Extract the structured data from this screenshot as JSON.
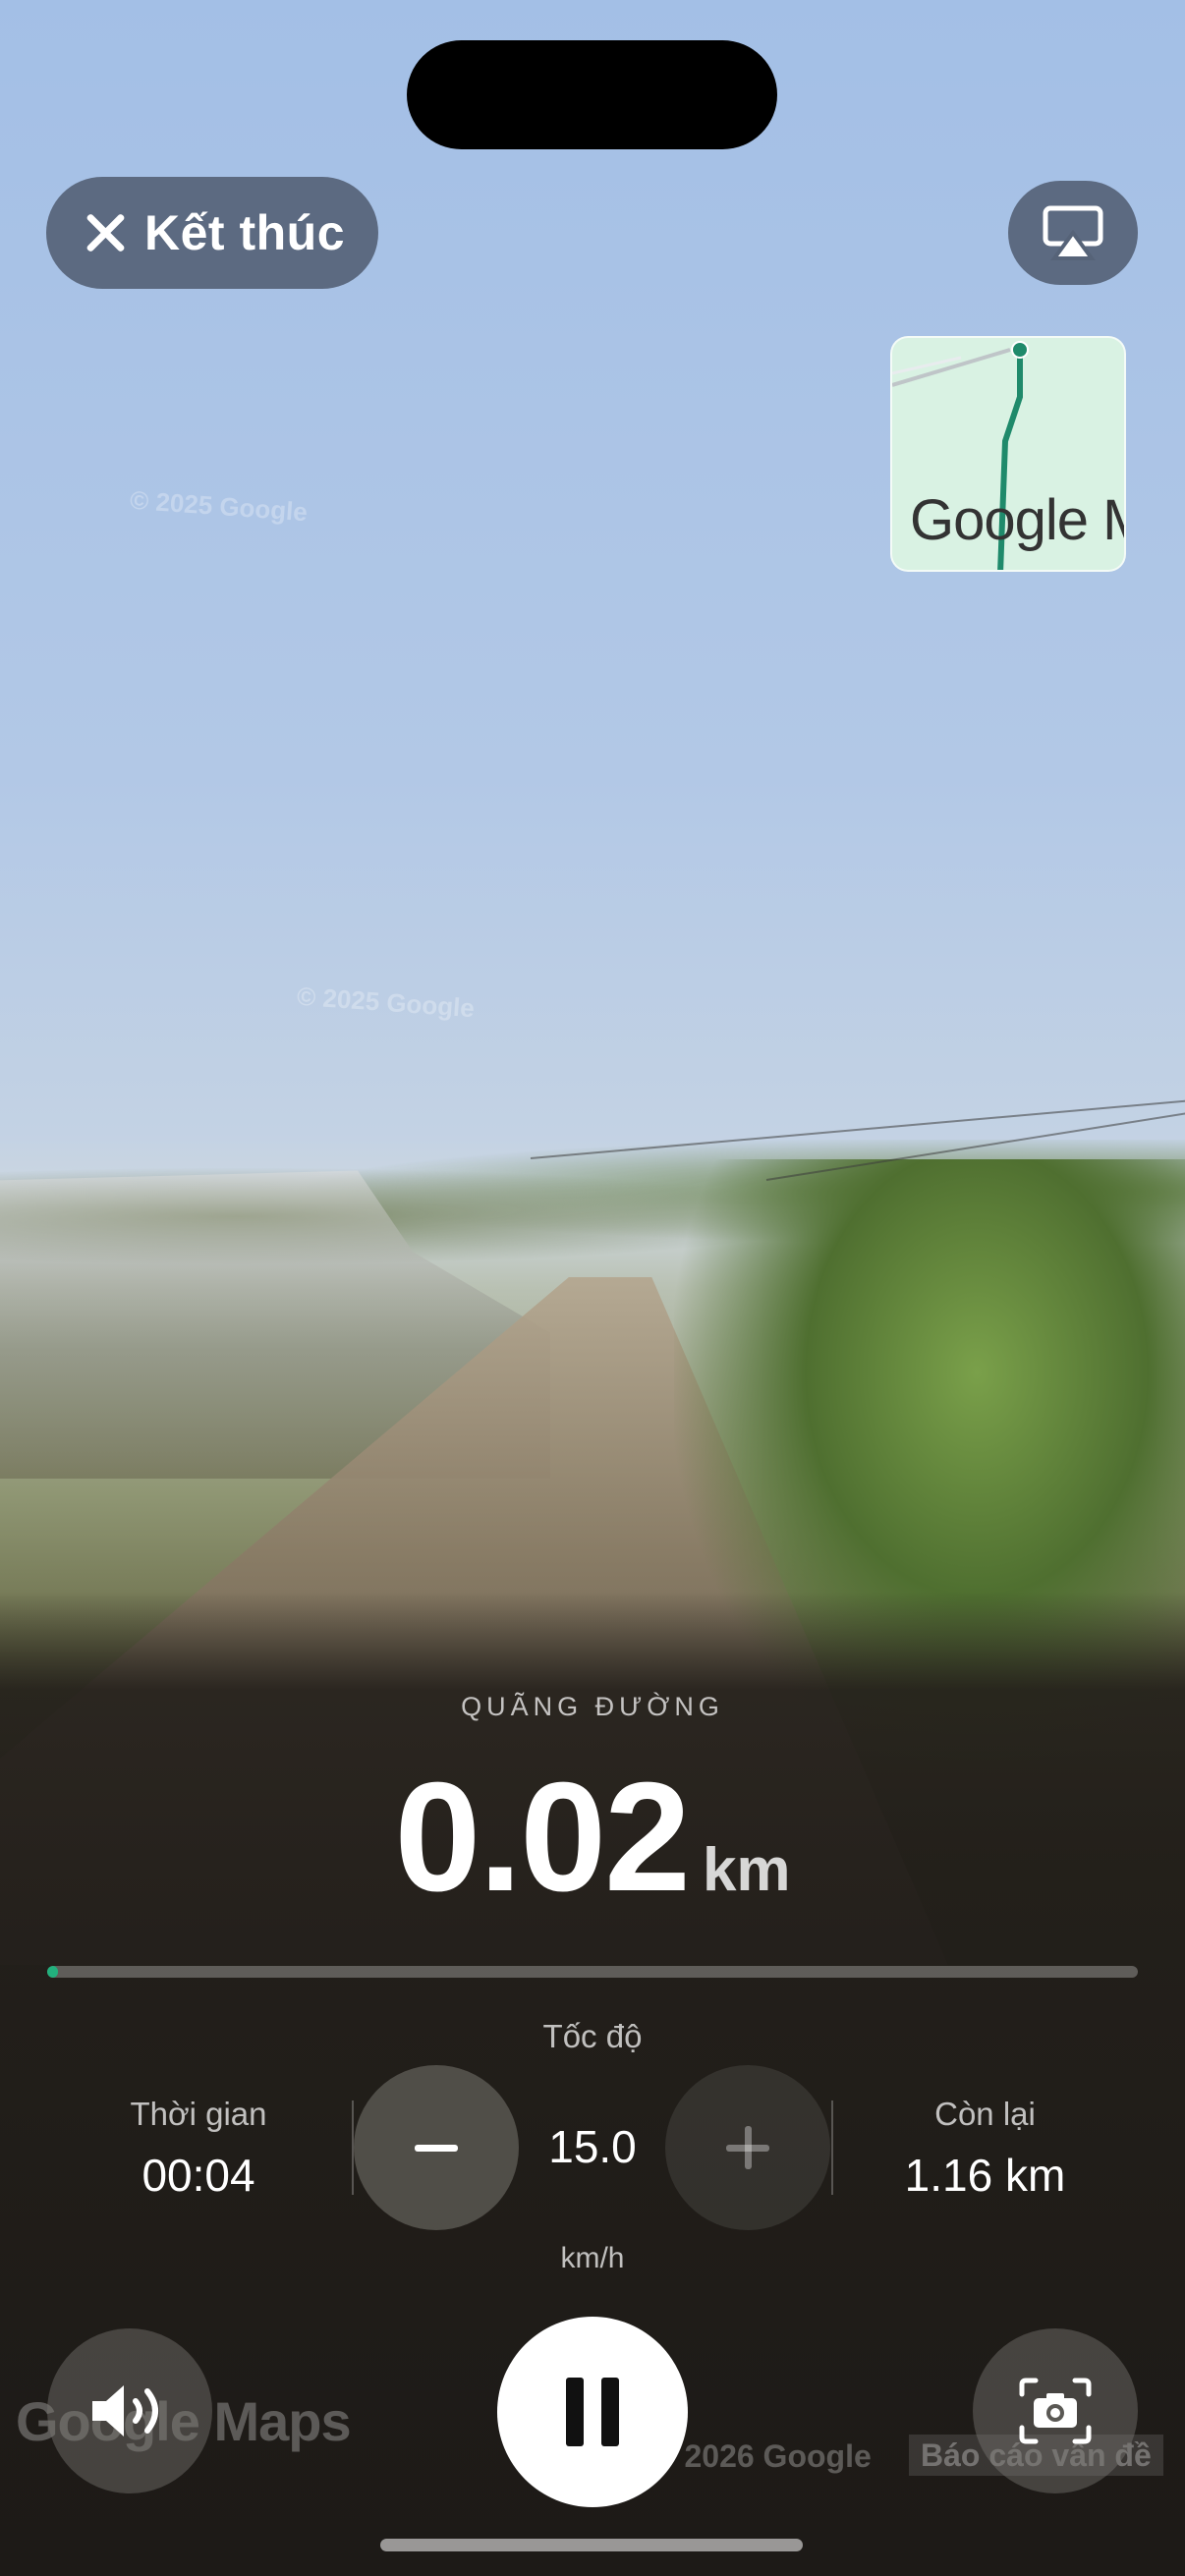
{
  "top_bar": {
    "end_button_label": "Kết thúc"
  },
  "minimap": {
    "label": "Google M"
  },
  "watermarks": {
    "street_view_1": "© 2025 Google",
    "street_view_2": "© 2025 Google",
    "google_maps": "Google Maps",
    "copyright": "© 2026 Google",
    "report": "Báo cáo vấn đề"
  },
  "distance": {
    "caption": "QUÃNG ĐƯỜNG",
    "value": "0.02",
    "unit": "km",
    "progress_fraction": 0.01
  },
  "speed": {
    "caption": "Tốc độ",
    "value": "15.0",
    "unit": "km/h"
  },
  "stats": {
    "time_label": "Thời gian",
    "time_value": "00:04",
    "remaining_label": "Còn lại",
    "remaining_value": "1.16 km"
  },
  "colors": {
    "accent": "#22b07d",
    "pill_background": "#566378"
  },
  "icons": [
    "close-icon",
    "airplay-icon",
    "minus-icon",
    "plus-icon",
    "speaker-icon",
    "pause-icon",
    "camera-capture-icon"
  ]
}
